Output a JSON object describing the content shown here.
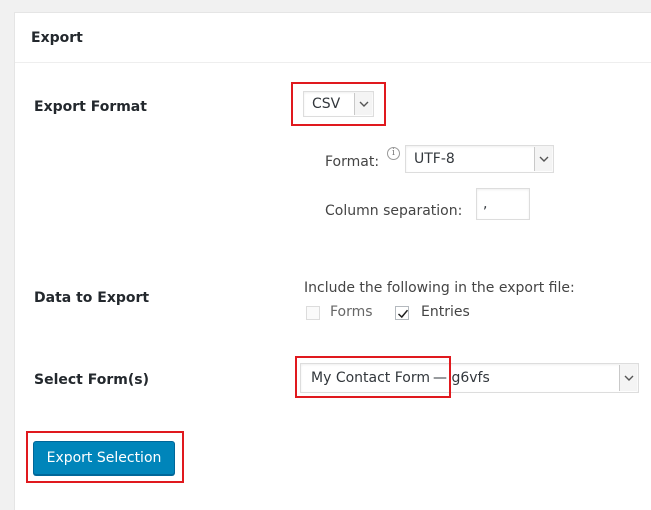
{
  "panel": {
    "title": "Export"
  },
  "export_format": {
    "label": "Export Format",
    "selected": "CSV",
    "format_label": "Format:",
    "format_selected": "UTF-8",
    "column_separation_label": "Column separation:",
    "column_separation_value": ","
  },
  "data_to_export": {
    "label": "Data to Export",
    "include_label": "Include the following in the export file:",
    "options": [
      {
        "label": "Forms",
        "checked": false,
        "disabled": true
      },
      {
        "label": "Entries",
        "checked": true,
        "disabled": false
      }
    ]
  },
  "select_forms": {
    "label": "Select Form(s)",
    "selected_name": "My Contact Form",
    "selected_suffix": "— g6vfs"
  },
  "actions": {
    "export_label": "Export Selection"
  },
  "colors": {
    "primary_button": "#0085ba",
    "highlight_box": "#e0191e",
    "panel_background": "#ffffff",
    "page_background": "#f1f1f1"
  }
}
